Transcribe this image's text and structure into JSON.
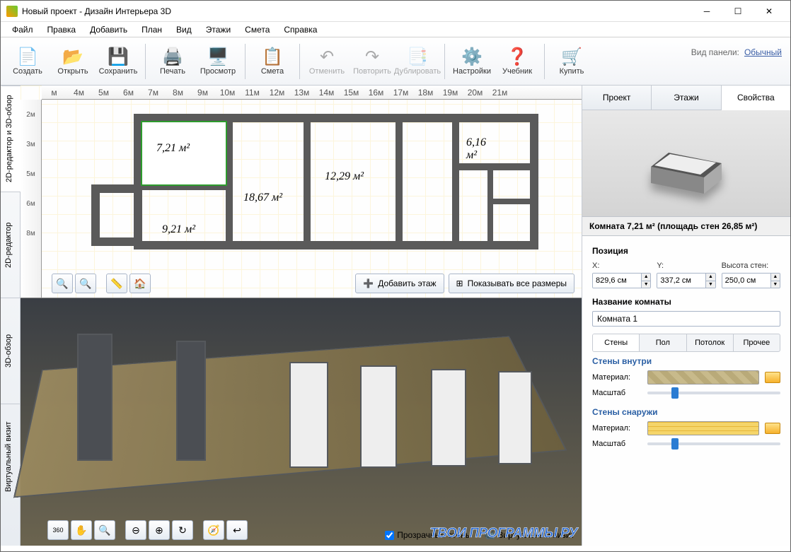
{
  "window": {
    "title": "Новый проект - Дизайн Интерьера 3D"
  },
  "menu": [
    "Файл",
    "Правка",
    "Добавить",
    "План",
    "Вид",
    "Этажи",
    "Смета",
    "Справка"
  ],
  "toolbar": [
    {
      "label": "Создать",
      "icon": "📄"
    },
    {
      "label": "Открыть",
      "icon": "📂"
    },
    {
      "label": "Сохранить",
      "icon": "💾"
    },
    {
      "sep": true
    },
    {
      "label": "Печать",
      "icon": "🖨️"
    },
    {
      "label": "Просмотр",
      "icon": "🖥️"
    },
    {
      "sep": true
    },
    {
      "label": "Смета",
      "icon": "📋"
    },
    {
      "sep": true
    },
    {
      "label": "Отменить",
      "icon": "↶",
      "disabled": true
    },
    {
      "label": "Повторить",
      "icon": "↷",
      "disabled": true
    },
    {
      "label": "Дублировать",
      "icon": "📑",
      "disabled": true
    },
    {
      "sep": true
    },
    {
      "label": "Настройки",
      "icon": "⚙️"
    },
    {
      "label": "Учебник",
      "icon": "❓"
    },
    {
      "sep": true
    },
    {
      "label": "Купить",
      "icon": "🛒"
    }
  ],
  "panel_mode": {
    "label": "Вид панели:",
    "value": "Обычный"
  },
  "side_tabs": [
    "2D-редактор и 3D-обзор",
    "2D-редактор",
    "3D-обзор",
    "Виртуальный визит"
  ],
  "ruler_h": [
    "м",
    "4м",
    "5м",
    "6м",
    "7м",
    "8м",
    "9м",
    "10м",
    "11м",
    "12м",
    "13м",
    "14м",
    "15м",
    "16м",
    "17м",
    "18м",
    "19м",
    "20м",
    "21м"
  ],
  "ruler_v": [
    "2м",
    "3м",
    "5м",
    "6м",
    "8м"
  ],
  "room_labels": {
    "r1": "7,21 м²",
    "r2": "6,16 м²",
    "r3": "12,29 м²",
    "r4": "18,67 м²",
    "r5": "9,21 м²"
  },
  "plan_btns": {
    "add_floor": "Добавить этаж",
    "show_dims": "Показывать все размеры"
  },
  "view3d": {
    "transparent": "Прозрачные стены",
    "virtual_visit": "Виртуальный визит"
  },
  "right": {
    "tabs": [
      "Проект",
      "Этажи",
      "Свойства"
    ],
    "room_title": "Комната 7,21 м²  (площадь стен 26,85 м²)",
    "pos_label": "Позиция",
    "x_label": "X:",
    "y_label": "Y:",
    "h_label": "Высота стен:",
    "x": "829,6 см",
    "y": "337,2 см",
    "h": "250,0 см",
    "name_label": "Название комнаты",
    "name": "Комната 1",
    "subtabs": [
      "Стены",
      "Пол",
      "Потолок",
      "Прочее"
    ],
    "walls_in": "Стены внутри",
    "walls_out": "Стены снаружи",
    "material": "Материал:",
    "scale": "Масштаб"
  },
  "watermark": "ТВОИ ПРОГРАММЫ РУ"
}
